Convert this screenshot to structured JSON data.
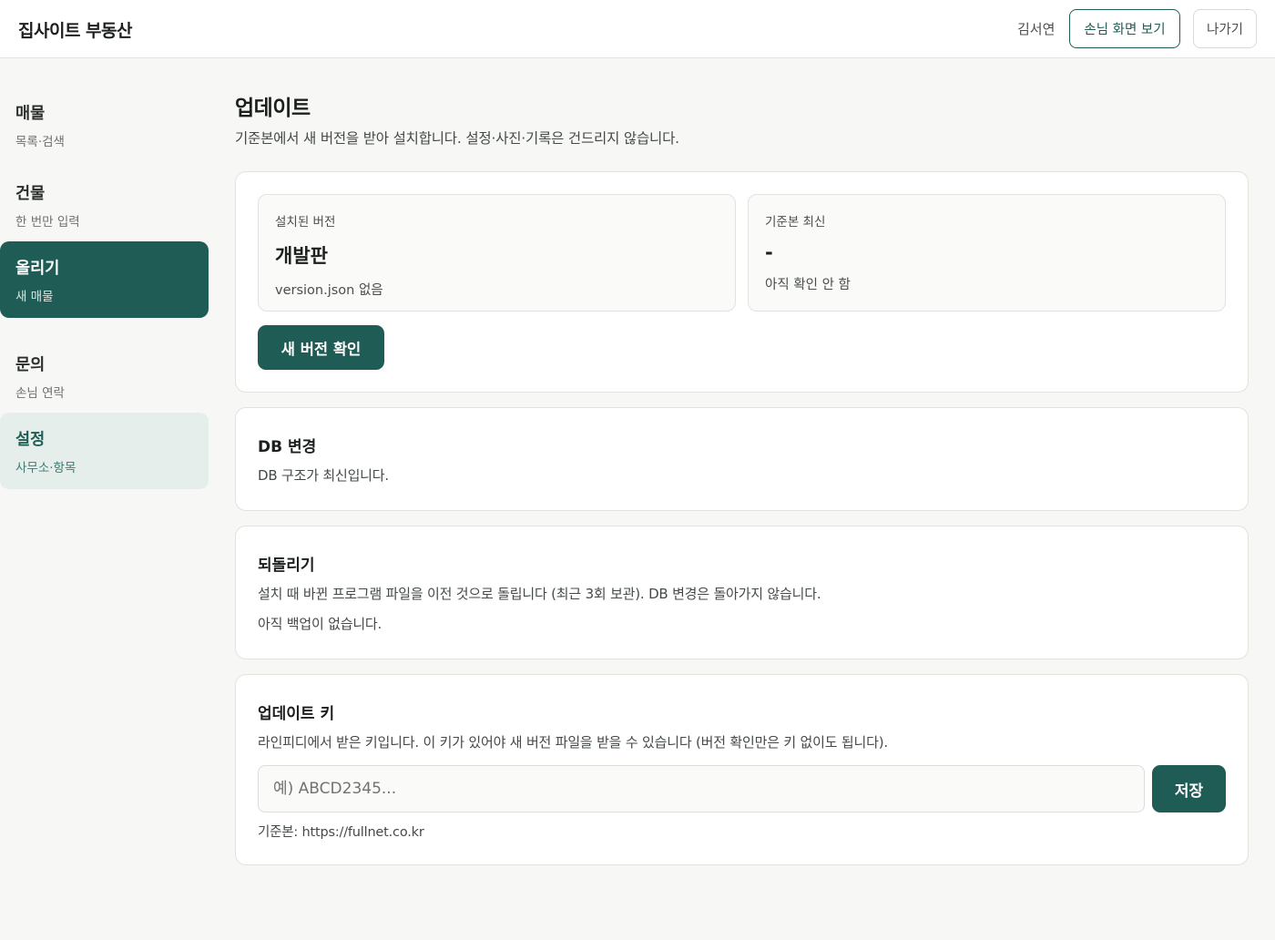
{
  "app": {
    "brand": "집사이트 부동산",
    "user_name": "김서연",
    "guest_view_label": "손님 화면 보기",
    "exit_label": "나가기"
  },
  "sidebar": {
    "items": [
      {
        "title": "매물",
        "sub": "목록·검색"
      },
      {
        "title": "건물",
        "sub": "한 번만 입력"
      },
      {
        "title": "올리기",
        "sub": "새 매물"
      },
      {
        "title": "문의",
        "sub": "손님 연락"
      },
      {
        "title": "설정",
        "sub": "사무소·항목"
      }
    ]
  },
  "main": {
    "title": "업데이트",
    "description": "기준본에서 새 버전을 받아 설치합니다. 설정·사진·기록은 건드리지 않습니다.",
    "version": {
      "installed_label": "설치된 버전",
      "installed_value": "개발판",
      "installed_note": "version.json 없음",
      "latest_label": "기준본 최신",
      "latest_value": "-",
      "latest_note": "아직 확인 안 함",
      "check_button": "새 버전 확인"
    },
    "db": {
      "title": "DB 변경",
      "text": "DB 구조가 최신입니다."
    },
    "rollback": {
      "title": "되돌리기",
      "text": "설치 때 바뀐 프로그램 파일을 이전 것으로 돌립니다 (최근 3회 보관). DB 변경은 돌아가지 않습니다.",
      "status": "아직 백업이 없습니다."
    },
    "key": {
      "title": "업데이트 키",
      "text": "라인피디에서 받은 키입니다. 이 키가 있어야 새 버전 파일을 받을 수 있습니다 (버전 확인만은 키 없이도 됩니다).",
      "placeholder": "예) ABCD2345...",
      "save_button": "저장",
      "base_url": "기준본: https://fullnet.co.kr"
    }
  },
  "colors": {
    "accent": "#1f5c55",
    "background": "#f7f7f5",
    "selected_bg": "#e6eeeb"
  }
}
